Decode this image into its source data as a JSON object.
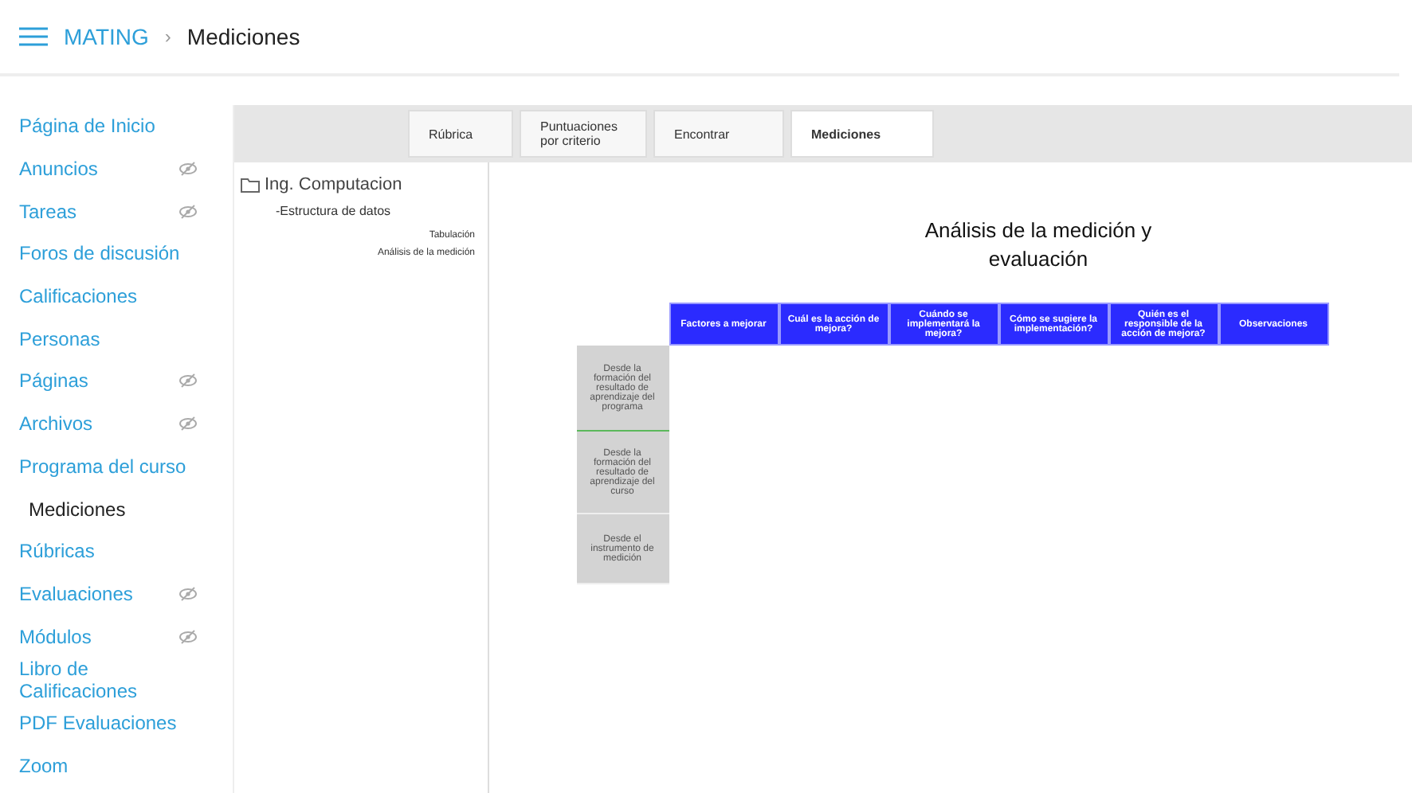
{
  "breadcrumb": {
    "course": "MATING",
    "separator": "›",
    "page": "Mediciones"
  },
  "sidebar": {
    "items": [
      {
        "label": "Página de Inicio",
        "hidden": false,
        "selected": false
      },
      {
        "label": "Anuncios",
        "hidden": true,
        "selected": false
      },
      {
        "label": "Tareas",
        "hidden": true,
        "selected": false
      },
      {
        "label": "Foros de discusión",
        "hidden": false,
        "selected": false
      },
      {
        "label": "Calificaciones",
        "hidden": false,
        "selected": false
      },
      {
        "label": "Personas",
        "hidden": false,
        "selected": false
      },
      {
        "label": "Páginas",
        "hidden": true,
        "selected": false
      },
      {
        "label": "Archivos",
        "hidden": true,
        "selected": false
      },
      {
        "label": "Programa del curso",
        "hidden": false,
        "selected": false
      },
      {
        "label": "Mediciones",
        "hidden": false,
        "selected": true
      },
      {
        "label": "Rúbricas",
        "hidden": false,
        "selected": false
      },
      {
        "label": "Evaluaciones",
        "hidden": true,
        "selected": false
      },
      {
        "label": "Módulos",
        "hidden": true,
        "selected": false
      },
      {
        "label": "Libro de Calificaciones",
        "hidden": false,
        "selected": false
      },
      {
        "label": "PDF Evaluaciones",
        "hidden": false,
        "selected": false
      },
      {
        "label": "Zoom",
        "hidden": false,
        "selected": false
      }
    ]
  },
  "tabs": [
    {
      "label": "Rúbrica",
      "selected": false
    },
    {
      "label": "Puntuaciones por criterio",
      "selected": false
    },
    {
      "label": "Encontrar",
      "selected": false
    },
    {
      "label": "Mediciones",
      "selected": true
    }
  ],
  "tree": {
    "label": "Ing. Computacion",
    "children": [
      {
        "label": "-Estructura de datos",
        "children": [
          {
            "label": "Tabulación"
          },
          {
            "label": "Análisis de la medición"
          }
        ]
      }
    ]
  },
  "main": {
    "title": "Análisis de la medición y evaluación",
    "table": {
      "columns": [
        "Factores a mejorar",
        "Cuál es la acción de mejora?",
        "Cuándo se implementará la mejora?",
        "Cómo se sugiere la implementación?",
        "Quién es el responsible de la acción de mejora?",
        "Observaciones"
      ],
      "rows": [
        "Desde la formación del resultado de aprendizaje del programa",
        "Desde la formación del resultado de aprendizaje del curso",
        "Desde el instrumento de medición"
      ]
    }
  }
}
